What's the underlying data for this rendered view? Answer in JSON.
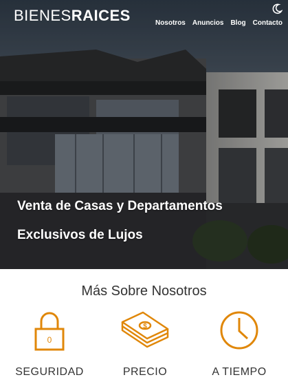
{
  "brand": {
    "light": "BIENES",
    "bold": "RAICES"
  },
  "nav": {
    "items": [
      {
        "label": "Nosotros"
      },
      {
        "label": "Anuncios"
      },
      {
        "label": "Blog"
      },
      {
        "label": "Contacto"
      }
    ]
  },
  "hero": {
    "line1": "Venta de Casas y Departamentos",
    "line2": "Exclusivos de Lujos"
  },
  "about": {
    "title": "Más Sobre Nosotros",
    "features": [
      {
        "label": "SEGURIDAD",
        "icon": "padlock-icon"
      },
      {
        "label": "PRECIO",
        "icon": "money-stack-icon"
      },
      {
        "label": "A TIEMPO",
        "icon": "clock-icon"
      }
    ]
  },
  "theme": {
    "accent": "#e08709",
    "text": "#333333"
  },
  "icons": {
    "dark_mode": "moon-icon"
  }
}
